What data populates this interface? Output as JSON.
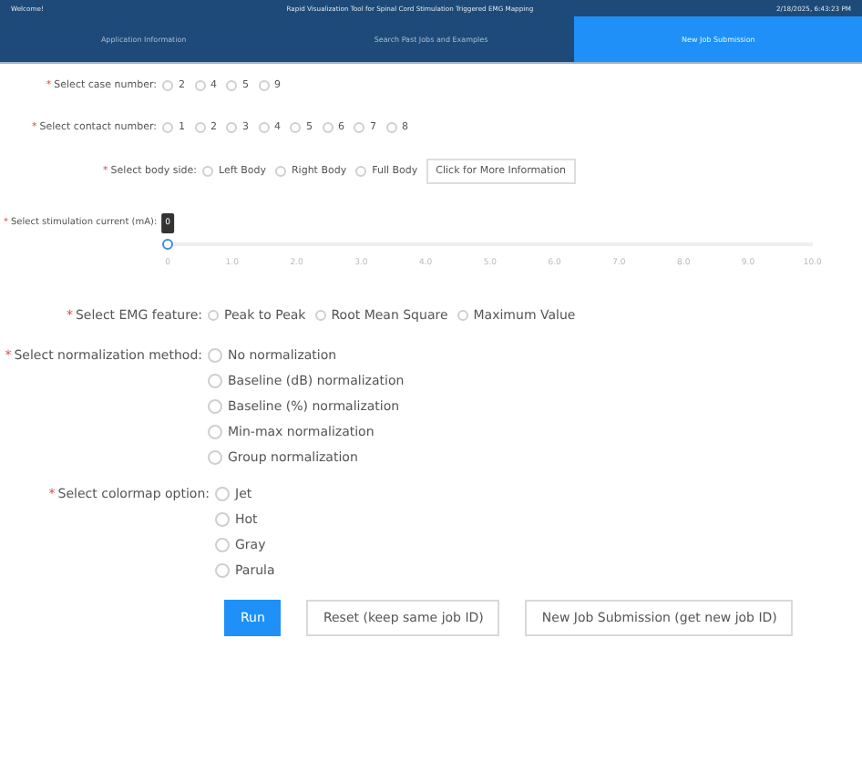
{
  "header": {
    "welcome": "Welcome!",
    "title": "Rapid Visualization Tool for Spinal Cord Stimulation Triggered EMG Mapping",
    "datetime": "2/18/2025, 6:43:23 PM"
  },
  "tabs": [
    {
      "label": "Application Information",
      "selected": false
    },
    {
      "label": "Search Past Jobs and Examples",
      "selected": false
    },
    {
      "label": "New Job Submission",
      "selected": true
    }
  ],
  "case_number": {
    "required_mark": "*",
    "label": "Select case number:",
    "options": [
      {
        "label": "2",
        "selected": false
      },
      {
        "label": "4",
        "selected": false
      },
      {
        "label": "5",
        "selected": false
      },
      {
        "label": "9",
        "selected": false
      }
    ]
  },
  "contact_number": {
    "required_mark": "*",
    "label": "Select contact number:",
    "options": [
      {
        "label": "1",
        "selected": false
      },
      {
        "label": "2",
        "selected": false
      },
      {
        "label": "3",
        "selected": false
      },
      {
        "label": "4",
        "selected": false
      },
      {
        "label": "5",
        "selected": false
      },
      {
        "label": "6",
        "selected": false
      },
      {
        "label": "7",
        "selected": false
      },
      {
        "label": "8",
        "selected": false
      }
    ]
  },
  "body_side": {
    "required_mark": "*",
    "label": "Select body side:",
    "options": [
      {
        "label": "Left Body",
        "selected": false
      },
      {
        "label": "Right Body",
        "selected": false
      },
      {
        "label": "Full Body",
        "selected": false
      }
    ],
    "info_button": "Click for More Information"
  },
  "stimulation_current": {
    "required_mark": "*",
    "label": "Select stimulation current (mA):",
    "tooltip": "0",
    "level": 0,
    "ticks": [
      "0",
      "1.0",
      "2.0",
      "3.0",
      "4.0",
      "5.0",
      "6.0",
      "7.0",
      "8.0",
      "9.0",
      "10.0"
    ]
  },
  "emg_feature": {
    "required_mark": "*",
    "label": "Select EMG feature:",
    "options": [
      {
        "label": "Peak to Peak",
        "selected": false
      },
      {
        "label": "Root Mean Square",
        "selected": false
      },
      {
        "label": "Maximum Value",
        "selected": false
      }
    ]
  },
  "normalization": {
    "required_mark": "*",
    "label": "Select normalization method:",
    "options": [
      {
        "label": "No normalization",
        "selected": false
      },
      {
        "label": "Baseline (dB) normalization",
        "selected": false
      },
      {
        "label": "Baseline (%) normalization",
        "selected": false
      },
      {
        "label": "Min-max normalization",
        "selected": false
      },
      {
        "label": "Group normalization",
        "selected": false
      }
    ]
  },
  "colormap": {
    "required_mark": "*",
    "label": "Select colormap option:",
    "options": [
      {
        "label": "Jet",
        "selected": false
      },
      {
        "label": "Hot",
        "selected": false
      },
      {
        "label": "Gray",
        "selected": false
      },
      {
        "label": "Parula",
        "selected": false
      }
    ]
  },
  "buttons": [
    {
      "label": "Run",
      "kind": "primary"
    },
    {
      "label": "Reset (keep same job ID)",
      "kind": "default"
    },
    {
      "label": "New Job Submission (get new job ID)",
      "kind": "default"
    }
  ]
}
